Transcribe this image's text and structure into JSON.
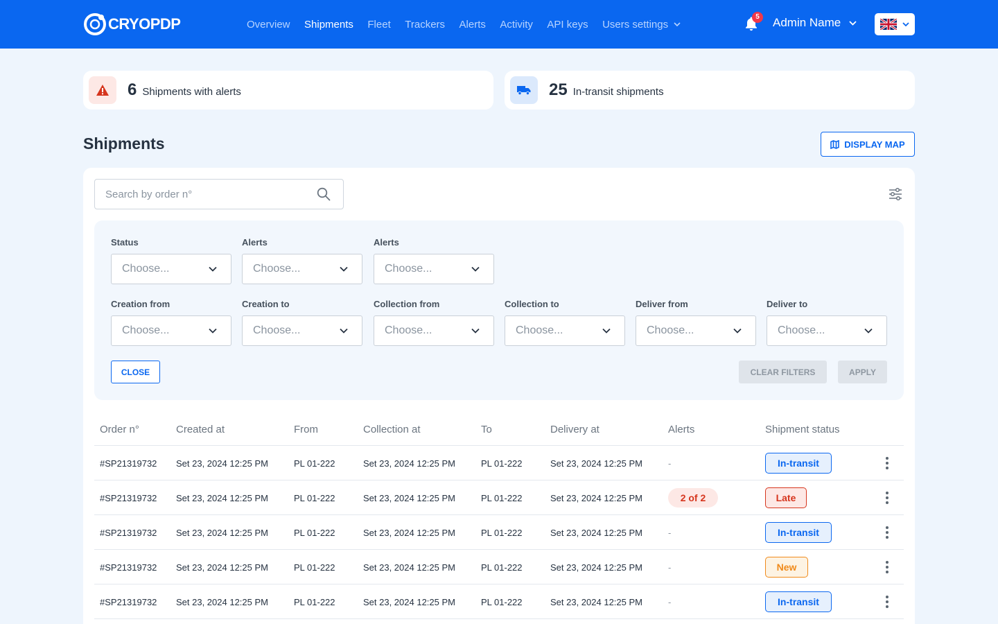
{
  "header": {
    "logo_text": "CRYOPDP",
    "nav": [
      {
        "label": "Overview",
        "active": false
      },
      {
        "label": "Shipments",
        "active": true
      },
      {
        "label": "Fleet",
        "active": false
      },
      {
        "label": "Trackers",
        "active": false
      },
      {
        "label": "Alerts",
        "active": false
      },
      {
        "label": "Activity",
        "active": false
      },
      {
        "label": "API keys",
        "active": false
      },
      {
        "label": "Users settings",
        "active": false,
        "dropdown": true
      }
    ],
    "notification_count": "5",
    "user_name": "Admin Name",
    "language_flag": "uk-flag-icon"
  },
  "stats": {
    "alerts": {
      "value": "6",
      "label": "Shipments with alerts",
      "icon": "warning-icon",
      "color": "#d6351d"
    },
    "in_transit": {
      "value": "25",
      "label": "In-transit shipments",
      "icon": "truck-icon",
      "color": "#0a67f0"
    }
  },
  "page": {
    "title": "Shipments",
    "display_map_label": "DISPLAY MAP"
  },
  "search": {
    "placeholder": "Search by order n°"
  },
  "filters": {
    "row1": [
      {
        "label": "Status",
        "value": "Choose..."
      },
      {
        "label": "Alerts",
        "value": "Choose..."
      },
      {
        "label": "Alerts",
        "value": "Choose..."
      }
    ],
    "row2": [
      {
        "label": "Creation from",
        "value": "Choose..."
      },
      {
        "label": "Creation to",
        "value": "Choose..."
      },
      {
        "label": "Collection from",
        "value": "Choose..."
      },
      {
        "label": "Collection to",
        "value": "Choose..."
      },
      {
        "label": "Deliver from",
        "value": "Choose..."
      },
      {
        "label": "Deliver to",
        "value": "Choose..."
      }
    ],
    "close_label": "CLOSE",
    "clear_label": "CLEAR FILTERS",
    "apply_label": "APPLY"
  },
  "table": {
    "columns": [
      "Order n°",
      "Created at",
      "From",
      "Collection at",
      "To",
      "Delivery at",
      "Alerts",
      "Shipment status"
    ],
    "rows": [
      {
        "order": "#SP21319732",
        "created": "Set 23, 2024 12:25 PM",
        "from": "PL 01-222",
        "collection": "Set 23, 2024 12:25 PM",
        "to": "PL 01-222",
        "delivery": "Set 23, 2024 12:25 PM",
        "alerts": "-",
        "status": "In-transit"
      },
      {
        "order": "#SP21319732",
        "created": "Set 23, 2024 12:25 PM",
        "from": "PL 01-222",
        "collection": "Set 23, 2024 12:25 PM",
        "to": "PL 01-222",
        "delivery": "Set 23, 2024 12:25 PM",
        "alerts": "2 of 2",
        "status": "Late"
      },
      {
        "order": "#SP21319732",
        "created": "Set 23, 2024 12:25 PM",
        "from": "PL 01-222",
        "collection": "Set 23, 2024 12:25 PM",
        "to": "PL 01-222",
        "delivery": "Set 23, 2024 12:25 PM",
        "alerts": "-",
        "status": "In-transit"
      },
      {
        "order": "#SP21319732",
        "created": "Set 23, 2024 12:25 PM",
        "from": "PL 01-222",
        "collection": "Set 23, 2024 12:25 PM",
        "to": "PL 01-222",
        "delivery": "Set 23, 2024 12:25 PM",
        "alerts": "-",
        "status": "New"
      },
      {
        "order": "#SP21319732",
        "created": "Set 23, 2024 12:25 PM",
        "from": "PL 01-222",
        "collection": "Set 23, 2024 12:25 PM",
        "to": "PL 01-222",
        "delivery": "Set 23, 2024 12:25 PM",
        "alerts": "-",
        "status": "In-transit"
      }
    ]
  },
  "colors": {
    "brand": "#0a67f0",
    "alert": "#d6351d",
    "new": "#f08a1a",
    "background": "#eef5fd"
  }
}
